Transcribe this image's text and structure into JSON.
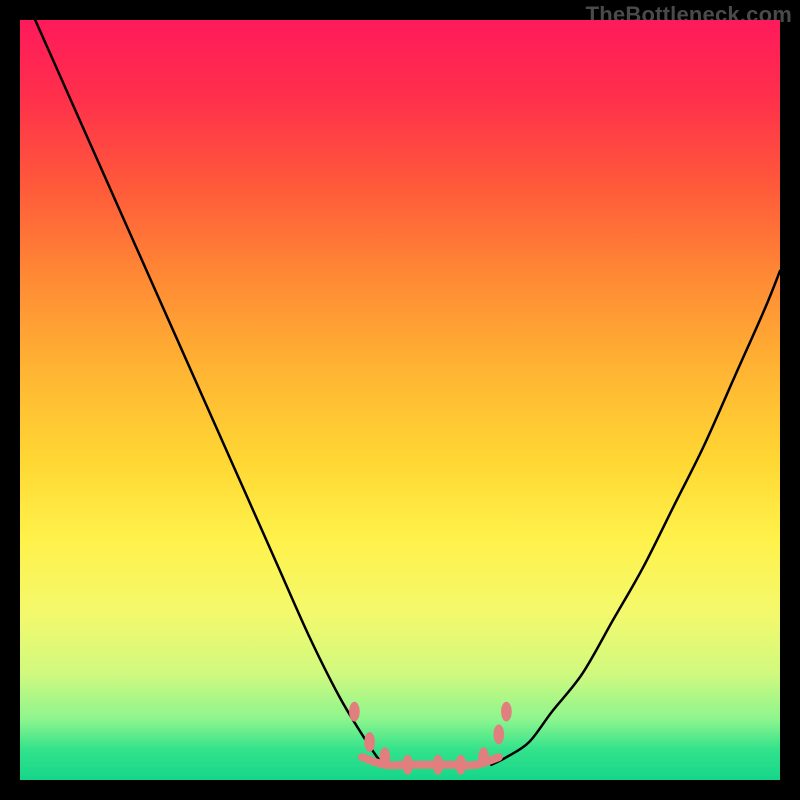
{
  "watermark": "TheBottleneck.com",
  "chart_data": {
    "type": "line",
    "title": "",
    "xlabel": "",
    "ylabel": "",
    "xlim": [
      0,
      100
    ],
    "ylim": [
      0,
      100
    ],
    "grid": false,
    "legend": false,
    "background": "rainbow-gradient (red top to green bottom)",
    "series": [
      {
        "name": "curve-left",
        "stroke": "#000000",
        "x": [
          2,
          6,
          10,
          14,
          18,
          22,
          26,
          30,
          34,
          38,
          42,
          45,
          47,
          48
        ],
        "y": [
          100,
          91,
          82,
          73,
          64,
          55,
          46,
          37,
          28,
          19,
          11,
          6,
          3,
          2
        ]
      },
      {
        "name": "curve-right",
        "stroke": "#000000",
        "x": [
          62,
          64,
          67,
          70,
          74,
          78,
          82,
          86,
          90,
          94,
          98,
          100
        ],
        "y": [
          2,
          3,
          5,
          9,
          14,
          21,
          28,
          36,
          44,
          53,
          62,
          67
        ]
      },
      {
        "name": "flat-bottom",
        "stroke": "#e07f7e",
        "x": [
          45,
          48,
          51,
          54,
          57,
          60,
          63
        ],
        "y": [
          3,
          2,
          2,
          2,
          2,
          2,
          3
        ]
      }
    ],
    "markers": [
      {
        "name": "dot-left-upper",
        "x": 44,
        "y": 9,
        "r": 1.0,
        "fill": "#e07f7e"
      },
      {
        "name": "dot-left-mid",
        "x": 46,
        "y": 5,
        "r": 1.0,
        "fill": "#e07f7e"
      },
      {
        "name": "dot-left-low",
        "x": 48,
        "y": 3,
        "r": 1.0,
        "fill": "#e07f7e"
      },
      {
        "name": "dot-center-1",
        "x": 51,
        "y": 2,
        "r": 1.0,
        "fill": "#e07f7e"
      },
      {
        "name": "dot-center-2",
        "x": 55,
        "y": 2,
        "r": 1.0,
        "fill": "#e07f7e"
      },
      {
        "name": "dot-center-3",
        "x": 58,
        "y": 2,
        "r": 1.0,
        "fill": "#e07f7e"
      },
      {
        "name": "dot-right-low",
        "x": 61,
        "y": 3,
        "r": 1.0,
        "fill": "#e07f7e"
      },
      {
        "name": "dot-right-mid",
        "x": 63,
        "y": 6,
        "r": 1.0,
        "fill": "#e07f7e"
      },
      {
        "name": "dot-right-upper",
        "x": 64,
        "y": 9,
        "r": 1.0,
        "fill": "#e07f7e"
      }
    ]
  }
}
